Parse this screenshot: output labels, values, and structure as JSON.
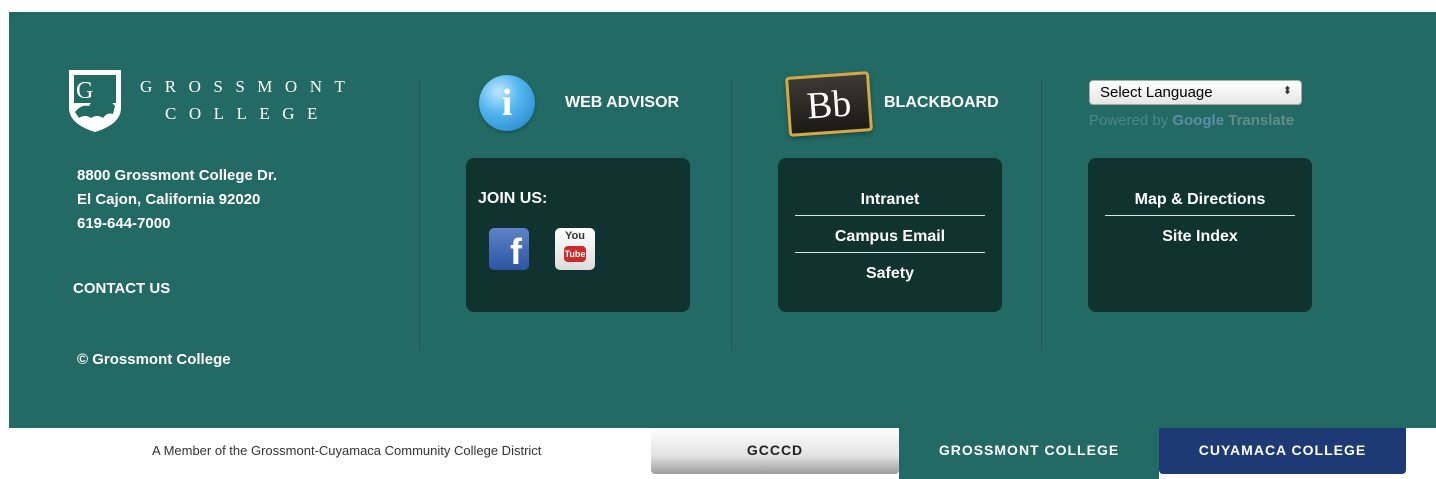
{
  "brand": {
    "name_line1": "GROSSMONT",
    "name_line2": "COLLEGE",
    "shield_letter": "G",
    "background_color": "#236a64"
  },
  "contact": {
    "address_line1": "8800 Grossmont College Dr.",
    "address_line2": "El Cajon, California 92020",
    "phone": "619-644-7000",
    "contact_link": "CONTACT US",
    "copyright": "© Grossmont College"
  },
  "quick_links": {
    "webadvisor_label": "WEB ADVISOR",
    "webadvisor_icon_glyph": "i",
    "blackboard_label": "BLACKBOARD",
    "blackboard_icon_glyph": "Bb"
  },
  "social": {
    "join_label": "JOIN US:",
    "facebook_glyph": "f",
    "youtube_top": "You",
    "youtube_bottom": "Tube"
  },
  "resources": {
    "items": [
      "Intranet",
      "Campus Email",
      "Safety"
    ]
  },
  "navigation": {
    "items": [
      "Map & Directions",
      "Site Index"
    ]
  },
  "translate": {
    "selected_value": "Select Language",
    "powered_by": "Powered by",
    "google": "Google",
    "translate": "Translate"
  },
  "district_bar": {
    "member_text": "A Member of the Grossmont-Cuyamaca Community College District",
    "tabs": [
      "GCCCD",
      "GROSSMONT COLLEGE",
      "CUYAMACA COLLEGE"
    ],
    "active_tab": "GROSSMONT COLLEGE",
    "colors": {
      "grossmont": "#236a64",
      "cuyamaca": "#1d3a75"
    }
  }
}
